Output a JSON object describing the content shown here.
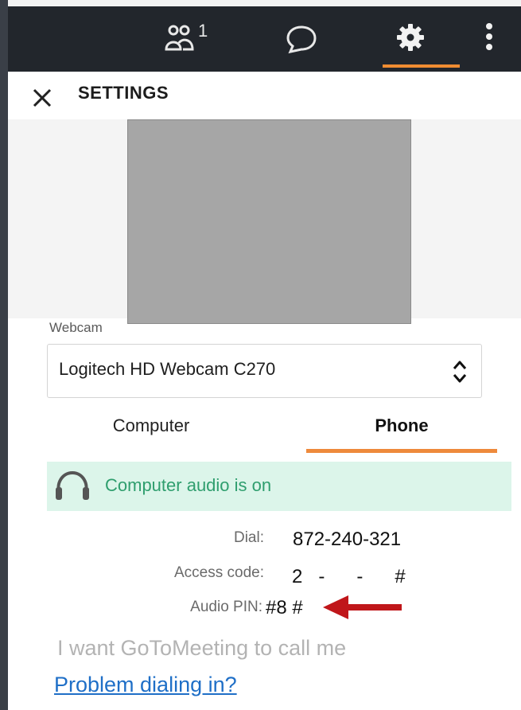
{
  "topbar": {
    "participants_icon": "people-icon",
    "participant_count": "1",
    "chat_icon": "chat-bubble-icon",
    "settings_icon": "gear-icon",
    "more_icon": "vertical-dots-icon",
    "accent": "#f08c32"
  },
  "settings": {
    "close_icon": "close-icon",
    "title": "SETTINGS"
  },
  "webcam": {
    "label": "Webcam",
    "selected": "Logitech HD Webcam C270"
  },
  "audio_tabs": [
    {
      "label": "Computer",
      "active": false
    },
    {
      "label": "Phone",
      "active": true
    }
  ],
  "audio_status": {
    "icon": "headset-icon",
    "text": "Computer audio is on",
    "color": "#2f9e6e"
  },
  "dial_info": {
    "dial_label": "Dial:",
    "dial_value": "872-240-321",
    "access_label": "Access code:",
    "access_value": "2   -      -      #",
    "pin_label": "Audio PIN:",
    "pin_value_a": "#8",
    "pin_value_b": "#"
  },
  "annotation": {
    "icon": "red-arrow-icon",
    "color": "#c0161a"
  },
  "links": {
    "call_me": "I want GoToMeeting to call me",
    "problem": "Problem dialing in?"
  }
}
